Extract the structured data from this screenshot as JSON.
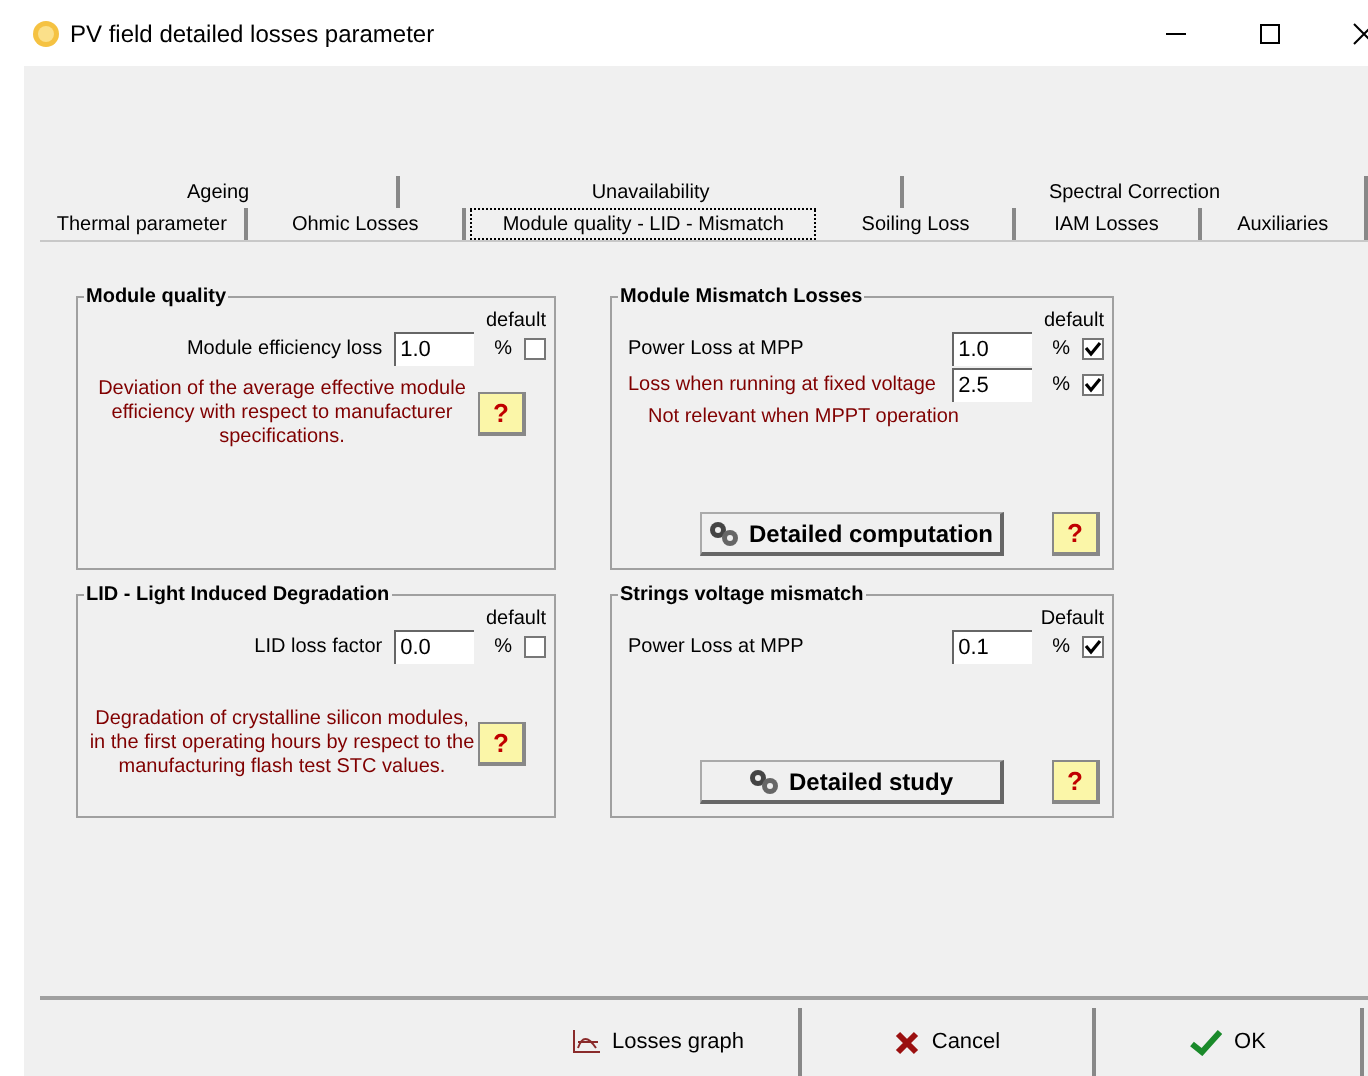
{
  "window": {
    "title": "PV field detailed losses parameter"
  },
  "tab_rows": [
    {
      "tabs": [
        {
          "label": "Ageing",
          "selected": false
        },
        {
          "label": "Unavailability",
          "selected": false
        },
        {
          "label": "Spectral Correction",
          "selected": false
        }
      ]
    },
    {
      "tabs": [
        {
          "label": "Thermal parameter",
          "selected": false
        },
        {
          "label": "Ohmic Losses",
          "selected": false
        },
        {
          "label": "Module quality - LID - Mismatch",
          "selected": true
        },
        {
          "label": "Soiling Loss",
          "selected": false
        },
        {
          "label": "IAM Losses",
          "selected": false
        },
        {
          "label": "Auxiliaries",
          "selected": false
        }
      ]
    }
  ],
  "groups": [
    {
      "title": "Module quality",
      "default_label": "default",
      "fields": [
        {
          "label": "Module efficiency loss",
          "value": "1.0",
          "unit": "%",
          "checked": false,
          "kind": "right"
        }
      ],
      "note": "Deviation of the average effective module efficiency with respect to manufacturer specifications.",
      "help": "?"
    },
    {
      "title": "Module Mismatch Losses",
      "default_label": "default",
      "fields": [
        {
          "label": "Power Loss at MPP",
          "value": "1.0",
          "unit": "%",
          "checked": true,
          "kind": "left"
        },
        {
          "label": "Loss when running at fixed voltage",
          "value": "2.5",
          "unit": "%",
          "checked": true,
          "kind": "warn",
          "sub": "Not relevant when MPPT operation"
        }
      ],
      "button": "Detailed computation",
      "help": "?"
    },
    {
      "title": "LID - Light Induced Degradation",
      "default_label": "default",
      "fields": [
        {
          "label": "LID loss factor",
          "value": "0.0",
          "unit": "%",
          "checked": false,
          "kind": "right"
        }
      ],
      "note": "Degradation of crystalline silicon modules, in the first operating hours by respect to the manufacturing flash test STC values.",
      "help": "?"
    },
    {
      "title": "Strings voltage mismatch",
      "default_label": "Default",
      "fields": [
        {
          "label": "Power Loss at MPP",
          "value": "0.1",
          "unit": "%",
          "checked": true,
          "kind": "left"
        }
      ],
      "button": "Detailed study",
      "help": "?"
    }
  ],
  "buttons": [
    {
      "label": "Losses graph",
      "kind": "graph"
    },
    {
      "label": "Cancel",
      "kind": "cancel"
    },
    {
      "label": "OK",
      "kind": "ok"
    }
  ]
}
